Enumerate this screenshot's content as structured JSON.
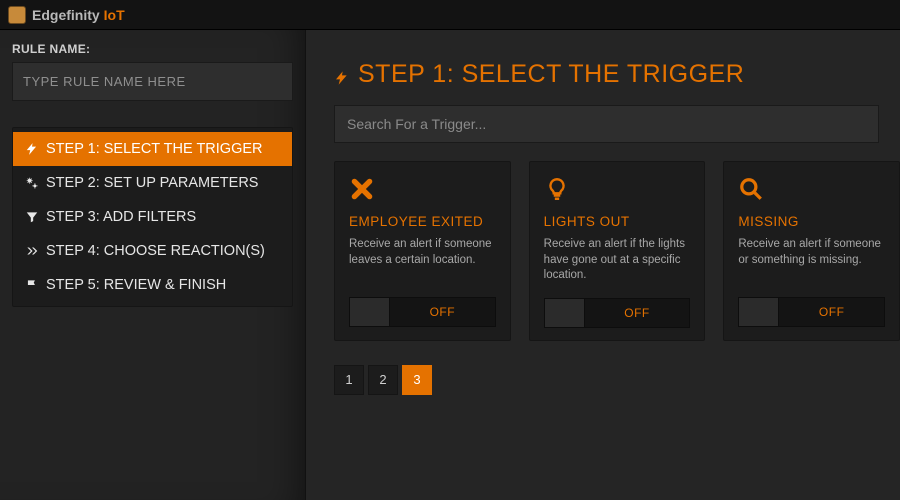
{
  "brand": {
    "name": "Edgefinity",
    "suffix": "IoT"
  },
  "sidebar": {
    "rule_label": "RULE NAME:",
    "rule_placeholder": "TYPE RULE NAME HERE",
    "steps": [
      {
        "label": "STEP 1: SELECT THE TRIGGER",
        "icon": "bolt",
        "active": true
      },
      {
        "label": "STEP 2: SET UP PARAMETERS",
        "icon": "gears",
        "active": false
      },
      {
        "label": "STEP 3: ADD FILTERS",
        "icon": "filter",
        "active": false
      },
      {
        "label": "STEP 4: CHOOSE REACTION(S)",
        "icon": "chevrons",
        "active": false
      },
      {
        "label": "STEP 5: REVIEW & FINISH",
        "icon": "flag",
        "active": false
      }
    ]
  },
  "main": {
    "heading": "STEP 1: SELECT THE TRIGGER",
    "search_placeholder": "Search For a Trigger...",
    "cards": [
      {
        "icon": "x",
        "title": "EMPLOYEE EXITED",
        "desc": "Receive an alert if someone leaves a certain location.",
        "toggle": "OFF"
      },
      {
        "icon": "bulb",
        "title": "LIGHTS OUT",
        "desc": "Receive an alert if the lights have gone out at a specific location.",
        "toggle": "OFF"
      },
      {
        "icon": "search",
        "title": "MISSING",
        "desc": "Receive an alert if someone or something is missing.",
        "toggle": "OFF"
      }
    ],
    "pages": [
      "1",
      "2",
      "3"
    ],
    "active_page": "3"
  },
  "colors": {
    "accent": "#e57200",
    "bg": "#212121",
    "panel": "#1c1c1c"
  }
}
